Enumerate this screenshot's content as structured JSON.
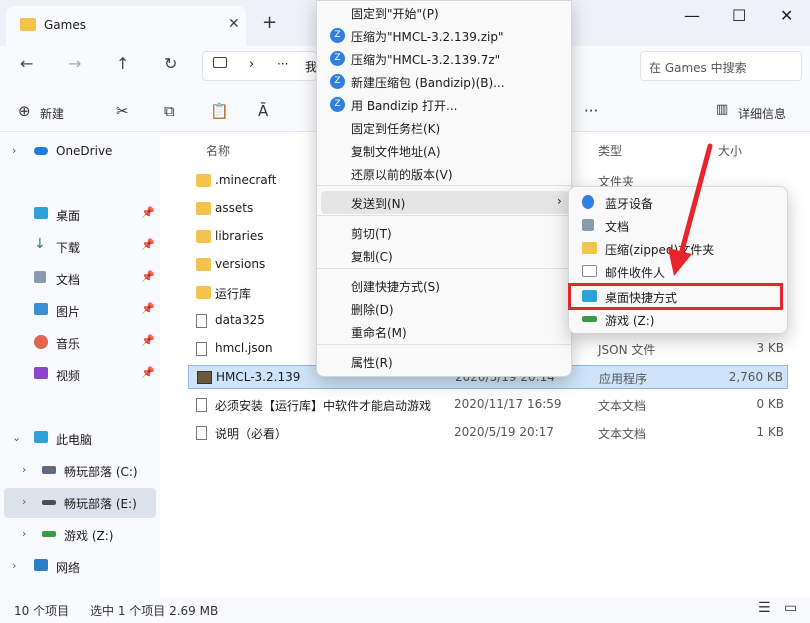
{
  "window": {
    "tab_title": "Games",
    "tab_close": "✕",
    "new_tab": "+",
    "minimize": "—",
    "maximize": "☐",
    "close": "✕"
  },
  "nav": {
    "back": "←",
    "forward": "→",
    "up": "↑",
    "refresh": "↻",
    "breadcrumb_more": "···",
    "breadcrumb_partial": "我",
    "search_placeholder": "在 Games 中搜索"
  },
  "toolbar": {
    "new_label": "新建",
    "more": "···",
    "details_label": "详细信息"
  },
  "sidebar": {
    "items": [
      {
        "label": "OneDrive",
        "chevron": "›",
        "pinned": false
      },
      {
        "label": "桌面",
        "chevron": "",
        "pinned": true
      },
      {
        "label": "下载",
        "chevron": "",
        "pinned": true
      },
      {
        "label": "文档",
        "chevron": "",
        "pinned": true
      },
      {
        "label": "图片",
        "chevron": "",
        "pinned": true
      },
      {
        "label": "音乐",
        "chevron": "",
        "pinned": true
      },
      {
        "label": "视频",
        "chevron": "",
        "pinned": true
      },
      {
        "label": "此电脑",
        "chevron": "⌄",
        "pinned": false
      },
      {
        "label": "畅玩部落 (C:)",
        "chevron": "›",
        "pinned": false
      },
      {
        "label": "畅玩部落 (E:)",
        "chevron": "›",
        "pinned": false
      },
      {
        "label": "游戏 (Z:)",
        "chevron": "›",
        "pinned": false
      },
      {
        "label": "网络",
        "chevron": "›",
        "pinned": false
      }
    ]
  },
  "list": {
    "headers": {
      "name": "名称",
      "type": "类型",
      "size": "大小"
    },
    "rows": [
      {
        "name": ".minecraft",
        "date": "",
        "type": "文件夹",
        "size": "",
        "kind": "folder"
      },
      {
        "name": "assets",
        "date": "",
        "type": "",
        "size": "",
        "kind": "folder"
      },
      {
        "name": "libraries",
        "date": "",
        "type": "",
        "size": "",
        "kind": "folder"
      },
      {
        "name": "versions",
        "date": "",
        "type": "",
        "size": "",
        "kind": "folder"
      },
      {
        "name": "运行库",
        "date": "",
        "type": "",
        "size": "",
        "kind": "folder"
      },
      {
        "name": "data325",
        "date": "",
        "type": "",
        "size": "",
        "kind": "file"
      },
      {
        "name": "hmcl.json",
        "date": "",
        "type": "JSON 文件",
        "size": "3 KB",
        "kind": "file"
      },
      {
        "name": "HMCL-3.2.139",
        "date": "2020/5/19 20:14",
        "type": "应用程序",
        "size": "2,760 KB",
        "kind": "app"
      },
      {
        "name": "必须安装【运行库】中软件才能启动游戏",
        "date": "2020/11/17 16:59",
        "type": "文本文档",
        "size": "0 KB",
        "kind": "file"
      },
      {
        "name": "说明（必看）",
        "date": "2020/5/19 20:17",
        "type": "文本文档",
        "size": "1 KB",
        "kind": "file"
      }
    ]
  },
  "status": {
    "count": "10 个项目",
    "selected": "选中 1 个项目  2.69 MB"
  },
  "context_menu": {
    "items": [
      {
        "label": "固定到\"开始\"(P)",
        "icon": ""
      },
      {
        "label": "压缩为\"HMCL-3.2.139.zip\"",
        "icon": "bandizip"
      },
      {
        "label": "压缩为\"HMCL-3.2.139.7z\"",
        "icon": "bandizip"
      },
      {
        "label": "新建压缩包 (Bandizip)(B)...",
        "icon": "bandizip"
      },
      {
        "label": "用 Bandizip 打开...",
        "icon": "bandizip"
      },
      {
        "label": "固定到任务栏(K)",
        "icon": ""
      },
      {
        "label": "复制文件地址(A)",
        "icon": ""
      },
      {
        "label": "还原以前的版本(V)",
        "icon": ""
      },
      {
        "label": "发送到(N)",
        "icon": "",
        "submenu": "›"
      },
      {
        "label": "剪切(T)",
        "icon": ""
      },
      {
        "label": "复制(C)",
        "icon": ""
      },
      {
        "label": "创建快捷方式(S)",
        "icon": ""
      },
      {
        "label": "删除(D)",
        "icon": ""
      },
      {
        "label": "重命名(M)",
        "icon": ""
      },
      {
        "label": "属性(R)",
        "icon": ""
      }
    ]
  },
  "send_to_menu": {
    "items": [
      {
        "label": "蓝牙设备",
        "icon": "bluetooth-icon"
      },
      {
        "label": "文档",
        "icon": "documents-icon"
      },
      {
        "label": "压缩(zipped)文件夹",
        "icon": "zip-folder-icon"
      },
      {
        "label": "邮件收件人",
        "icon": "mail-icon"
      },
      {
        "label": "桌面快捷方式",
        "icon": "desktop-icon"
      },
      {
        "label": "游戏 (Z:)",
        "icon": "drive-icon"
      }
    ]
  },
  "colors": {
    "highlight_box": "#e8252d",
    "selection": "#cfe4fa",
    "bandizip": "#2f7fe0"
  }
}
